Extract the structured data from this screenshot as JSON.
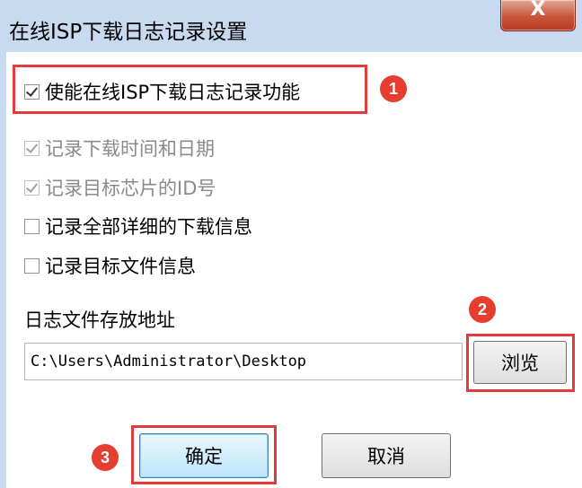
{
  "window": {
    "title": "在线ISP下载日志记录设置",
    "close_label": "X"
  },
  "options": {
    "enable_logging": {
      "label": "使能在线ISP下载日志记录功能",
      "checked": true
    },
    "record_time": {
      "label": "记录下载时间和日期",
      "checked": true,
      "disabled": true
    },
    "record_chip_id": {
      "label": "记录目标芯片的ID号",
      "checked": true,
      "disabled": true
    },
    "record_details": {
      "label": "记录全部详细的下载信息",
      "checked": false
    },
    "record_file_info": {
      "label": "记录目标文件信息",
      "checked": false
    }
  },
  "log_path": {
    "label": "日志文件存放地址",
    "value": "C:\\Users\\Administrator\\Desktop"
  },
  "buttons": {
    "browse": "浏览",
    "ok": "确定",
    "cancel": "取消"
  },
  "badges": {
    "b1": "1",
    "b2": "2",
    "b3": "3"
  },
  "colors": {
    "highlight": "#e23b3b",
    "badge": "#e53d2f",
    "titlebar": "#c7daf0"
  }
}
